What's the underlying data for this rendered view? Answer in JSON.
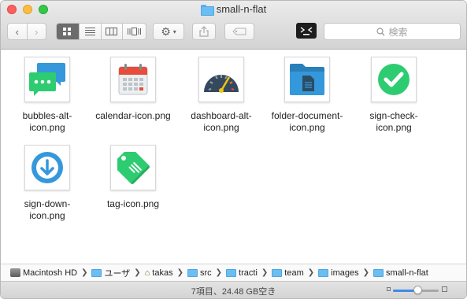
{
  "window": {
    "title": "small-n-flat",
    "search_placeholder": "検索"
  },
  "toolbar": {
    "view_modes": [
      "icon-view",
      "list-view",
      "column-view",
      "cover-flow-view"
    ],
    "active_view": "icon-view"
  },
  "files": [
    {
      "name": "bubbles-alt-\nicon.png",
      "icon": "chat-bubbles-icon"
    },
    {
      "name": "calendar-icon.png",
      "icon": "calendar-icon"
    },
    {
      "name": "dashboard-alt-\nicon.png",
      "icon": "gauge-icon"
    },
    {
      "name": "folder-document-\nicon.png",
      "icon": "folder-document-icon"
    },
    {
      "name": "sign-check-\nicon.png",
      "icon": "check-circle-icon"
    },
    {
      "name": "sign-down-\nicon.png",
      "icon": "down-arrow-circle-icon"
    },
    {
      "name": "tag-icon.png",
      "icon": "tag-icon"
    }
  ],
  "pathbar": {
    "items": [
      "Macintosh HD",
      "ユーザ",
      "takas",
      "src",
      "tracti",
      "team",
      "images",
      "small-n-flat"
    ]
  },
  "statusbar": {
    "text": "7項目、24.48 GB空き",
    "zoom_fraction": 0.56
  },
  "colors": {
    "folder": "#6cbdf1",
    "green": "#2ecc71",
    "blue": "#3498db",
    "accent": "#3f8ae8"
  }
}
